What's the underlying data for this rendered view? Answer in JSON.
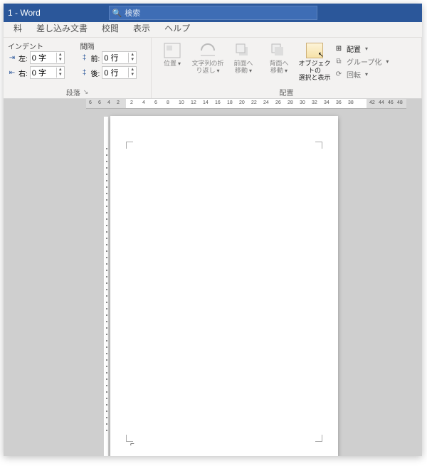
{
  "title_suffix": "1  -  Word",
  "search_placeholder": "検索",
  "tabs": {
    "t1": "料",
    "t2": "差し込み文書",
    "t3": "校閲",
    "t4": "表示",
    "t5": "ヘルプ"
  },
  "indent": {
    "header": "インデント",
    "left_label": "左:",
    "left_value": "0 字",
    "right_label": "右:",
    "right_value": "0 字"
  },
  "spacing": {
    "header": "間隔",
    "before_label": "前:",
    "before_value": "0 行",
    "after_label": "後:",
    "after_value": "0 行"
  },
  "group_paragraph": "段落",
  "arrange": {
    "pos": "位置",
    "wrap": "文字列の折\nり返し",
    "fwd": "前面へ\n移動",
    "back": "背面へ\n移動",
    "selpane": "オブジェクトの\n選択と表示",
    "align": "配置",
    "group": "グループ化",
    "rotate": "回転",
    "title": "配置"
  },
  "ruler_left": [
    "6",
    "6",
    "4",
    "2"
  ],
  "ruler_nums": [
    "2",
    "4",
    "6",
    "8",
    "10",
    "12",
    "14",
    "16",
    "18",
    "20",
    "22",
    "24",
    "26",
    "28",
    "30",
    "32",
    "34",
    "36",
    "38"
  ],
  "ruler_right": [
    "42",
    "44",
    "46",
    "48"
  ]
}
